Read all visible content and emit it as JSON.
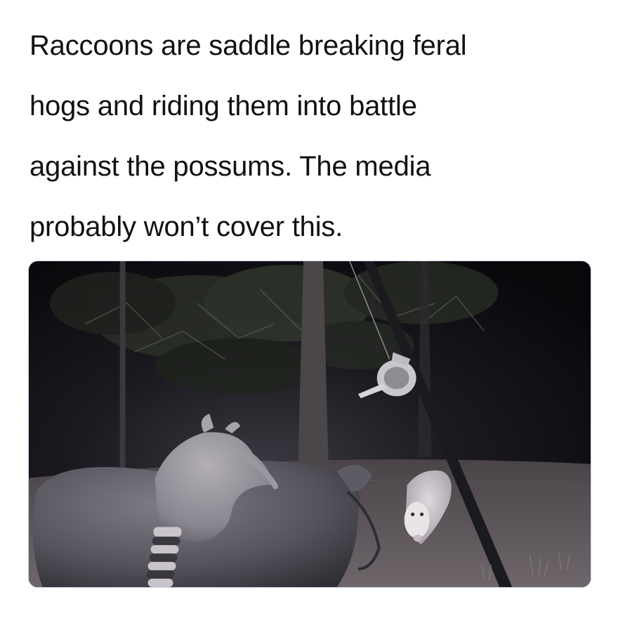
{
  "caption": {
    "lines": [
      "Raccoons are saddle breaking feral",
      "hogs and riding them into battle",
      "against the possums. The media",
      "probably won’t cover this."
    ]
  },
  "photo": {
    "subjects": [
      "raccoon",
      "feral-hog",
      "opossum",
      "trees",
      "feeder-pole"
    ]
  }
}
